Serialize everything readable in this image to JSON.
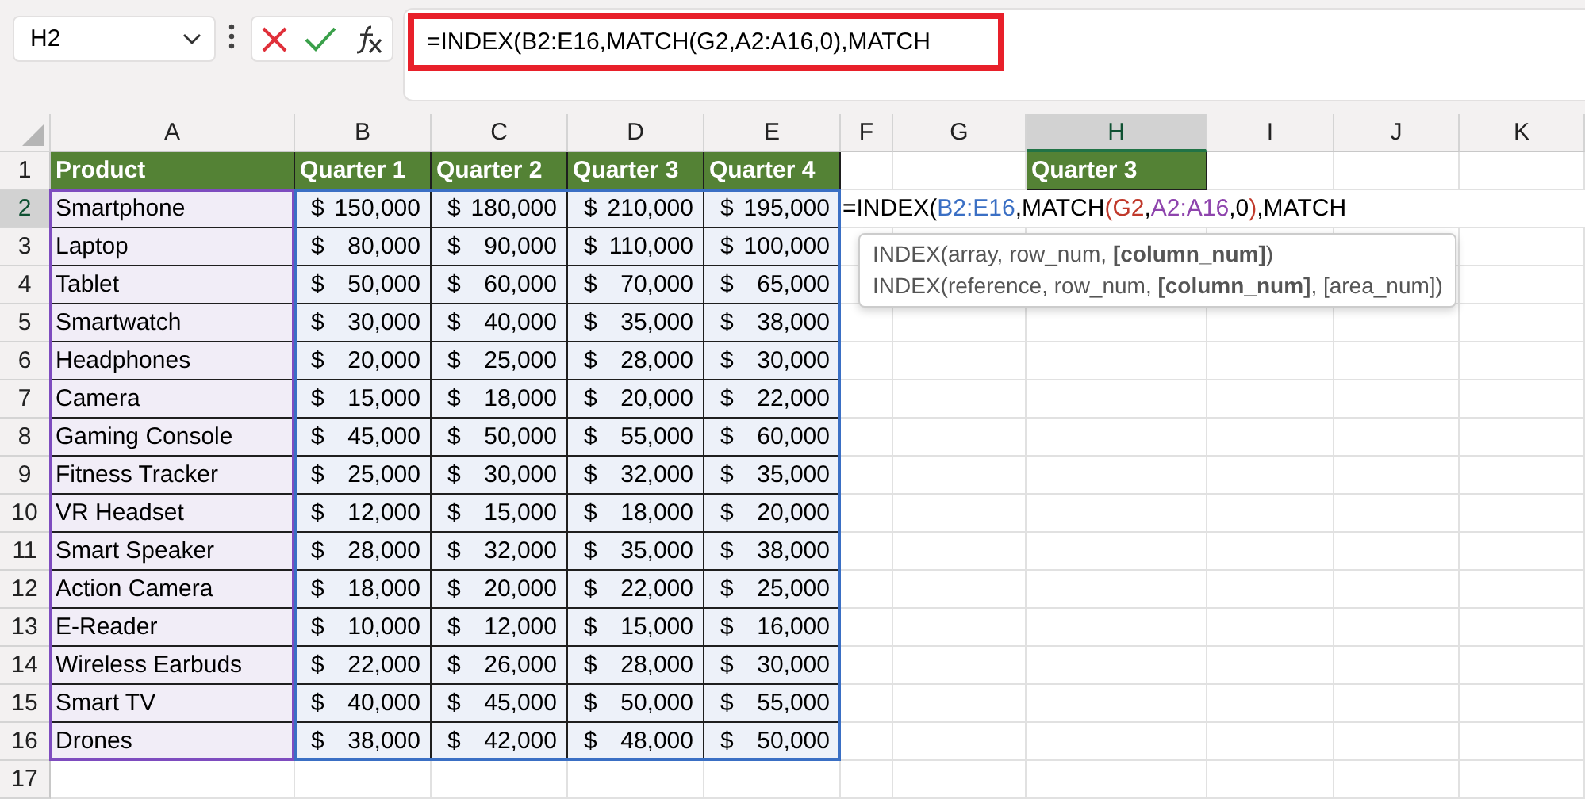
{
  "name_box": {
    "value": "H2"
  },
  "formula_bar": {
    "value": "=INDEX(B2:E16,MATCH(G2,A2:A16,0),MATCH"
  },
  "columns": [
    {
      "label": "A",
      "selected": false
    },
    {
      "label": "B",
      "selected": false
    },
    {
      "label": "C",
      "selected": false
    },
    {
      "label": "D",
      "selected": false
    },
    {
      "label": "E",
      "selected": false
    },
    {
      "label": "F",
      "selected": false
    },
    {
      "label": "G",
      "selected": false
    },
    {
      "label": "H",
      "selected": true
    },
    {
      "label": "I",
      "selected": false
    },
    {
      "label": "J",
      "selected": false
    },
    {
      "label": "K",
      "selected": false
    }
  ],
  "row_numbers": [
    {
      "label": "1",
      "selected": false
    },
    {
      "label": "2",
      "selected": true
    },
    {
      "label": "3",
      "selected": false
    },
    {
      "label": "4",
      "selected": false
    },
    {
      "label": "5",
      "selected": false
    },
    {
      "label": "6",
      "selected": false
    },
    {
      "label": "7",
      "selected": false
    },
    {
      "label": "8",
      "selected": false
    },
    {
      "label": "9",
      "selected": false
    },
    {
      "label": "10",
      "selected": false
    },
    {
      "label": "11",
      "selected": false
    },
    {
      "label": "12",
      "selected": false
    },
    {
      "label": "13",
      "selected": false
    },
    {
      "label": "14",
      "selected": false
    },
    {
      "label": "15",
      "selected": false
    },
    {
      "label": "16",
      "selected": false
    },
    {
      "label": "17",
      "selected": false
    }
  ],
  "table": {
    "headers": [
      "Product",
      "Quarter 1",
      "Quarter 2",
      "Quarter 3",
      "Quarter 4"
    ],
    "rows": [
      {
        "product": "Smartphone",
        "values": [
          {
            "currency": "$",
            "amount": "150,000"
          },
          {
            "currency": "$",
            "amount": "180,000"
          },
          {
            "currency": "$",
            "amount": "210,000"
          },
          {
            "currency": "$",
            "amount": "195,000"
          }
        ]
      },
      {
        "product": "Laptop",
        "values": [
          {
            "currency": "$",
            "amount": "80,000"
          },
          {
            "currency": "$",
            "amount": "90,000"
          },
          {
            "currency": "$",
            "amount": "110,000"
          },
          {
            "currency": "$",
            "amount": "100,000"
          }
        ]
      },
      {
        "product": "Tablet",
        "values": [
          {
            "currency": "$",
            "amount": "50,000"
          },
          {
            "currency": "$",
            "amount": "60,000"
          },
          {
            "currency": "$",
            "amount": "70,000"
          },
          {
            "currency": "$",
            "amount": "65,000"
          }
        ]
      },
      {
        "product": "Smartwatch",
        "values": [
          {
            "currency": "$",
            "amount": "30,000"
          },
          {
            "currency": "$",
            "amount": "40,000"
          },
          {
            "currency": "$",
            "amount": "35,000"
          },
          {
            "currency": "$",
            "amount": "38,000"
          }
        ]
      },
      {
        "product": "Headphones",
        "values": [
          {
            "currency": "$",
            "amount": "20,000"
          },
          {
            "currency": "$",
            "amount": "25,000"
          },
          {
            "currency": "$",
            "amount": "28,000"
          },
          {
            "currency": "$",
            "amount": "30,000"
          }
        ]
      },
      {
        "product": "Camera",
        "values": [
          {
            "currency": "$",
            "amount": "15,000"
          },
          {
            "currency": "$",
            "amount": "18,000"
          },
          {
            "currency": "$",
            "amount": "20,000"
          },
          {
            "currency": "$",
            "amount": "22,000"
          }
        ]
      },
      {
        "product": "Gaming Console",
        "values": [
          {
            "currency": "$",
            "amount": "45,000"
          },
          {
            "currency": "$",
            "amount": "50,000"
          },
          {
            "currency": "$",
            "amount": "55,000"
          },
          {
            "currency": "$",
            "amount": "60,000"
          }
        ]
      },
      {
        "product": "Fitness Tracker",
        "values": [
          {
            "currency": "$",
            "amount": "25,000"
          },
          {
            "currency": "$",
            "amount": "30,000"
          },
          {
            "currency": "$",
            "amount": "32,000"
          },
          {
            "currency": "$",
            "amount": "35,000"
          }
        ]
      },
      {
        "product": "VR Headset",
        "values": [
          {
            "currency": "$",
            "amount": "12,000"
          },
          {
            "currency": "$",
            "amount": "15,000"
          },
          {
            "currency": "$",
            "amount": "18,000"
          },
          {
            "currency": "$",
            "amount": "20,000"
          }
        ]
      },
      {
        "product": "Smart Speaker",
        "values": [
          {
            "currency": "$",
            "amount": "28,000"
          },
          {
            "currency": "$",
            "amount": "32,000"
          },
          {
            "currency": "$",
            "amount": "35,000"
          },
          {
            "currency": "$",
            "amount": "38,000"
          }
        ]
      },
      {
        "product": "Action Camera",
        "values": [
          {
            "currency": "$",
            "amount": "18,000"
          },
          {
            "currency": "$",
            "amount": "20,000"
          },
          {
            "currency": "$",
            "amount": "22,000"
          },
          {
            "currency": "$",
            "amount": "25,000"
          }
        ]
      },
      {
        "product": "E-Reader",
        "values": [
          {
            "currency": "$",
            "amount": "10,000"
          },
          {
            "currency": "$",
            "amount": "12,000"
          },
          {
            "currency": "$",
            "amount": "15,000"
          },
          {
            "currency": "$",
            "amount": "16,000"
          }
        ]
      },
      {
        "product": "Wireless Earbuds",
        "values": [
          {
            "currency": "$",
            "amount": "22,000"
          },
          {
            "currency": "$",
            "amount": "26,000"
          },
          {
            "currency": "$",
            "amount": "28,000"
          },
          {
            "currency": "$",
            "amount": "30,000"
          }
        ]
      },
      {
        "product": "Smart TV",
        "values": [
          {
            "currency": "$",
            "amount": "40,000"
          },
          {
            "currency": "$",
            "amount": "45,000"
          },
          {
            "currency": "$",
            "amount": "50,000"
          },
          {
            "currency": "$",
            "amount": "55,000"
          }
        ]
      },
      {
        "product": "Drones",
        "values": [
          {
            "currency": "$",
            "amount": "38,000"
          },
          {
            "currency": "$",
            "amount": "42,000"
          },
          {
            "currency": "$",
            "amount": "48,000"
          },
          {
            "currency": "$",
            "amount": "50,000"
          }
        ]
      }
    ]
  },
  "lookup_header": "Quarter 3",
  "cell_formula": [
    {
      "text": "=INDEX(",
      "color": "#000000"
    },
    {
      "text": "B2:E16",
      "color": "#3a6fc4"
    },
    {
      "text": ",MATCH",
      "color": "#000000"
    },
    {
      "text": "(",
      "color": "#c0392b"
    },
    {
      "text": "G2",
      "color": "#c0392b"
    },
    {
      "text": ",",
      "color": "#000000"
    },
    {
      "text": "A2:A16",
      "color": "#8e44ad"
    },
    {
      "text": ",0",
      "color": "#000000"
    },
    {
      "text": ")",
      "color": "#c0392b"
    },
    {
      "text": ",MATCH",
      "color": "#000000"
    }
  ],
  "tooltip": {
    "lines": [
      "INDEX(array, row_num, **[column_num]**)",
      "INDEX(reference, row_num, **[column_num]**, [area_num])"
    ]
  }
}
